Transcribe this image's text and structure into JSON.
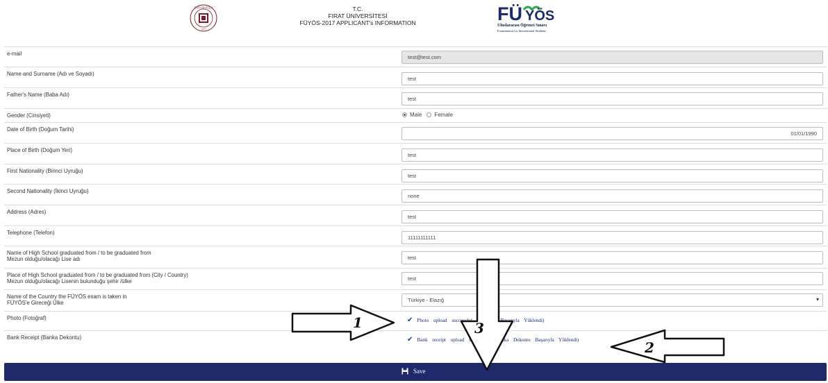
{
  "header": {
    "line1": "T.C.",
    "line2": "FIRAT ÜNİVERSİTESİ",
    "line3": "FÜYÖS-2017 APPLICANT's INFORMATION",
    "fuyos_logo": "FÜYÖS",
    "fuyos_sub1": "Uluslararası Öğrenci Sınavı",
    "fuyos_sub2": "Examination for International Students"
  },
  "form": {
    "email": {
      "label": "e-mail",
      "value": "test@test.com"
    },
    "name": {
      "label": "Name and Surname (Adı ve Soyadı)",
      "value": "test"
    },
    "father": {
      "label": "Father's Name (Baba Adı)",
      "value": "test"
    },
    "gender": {
      "label": "Gender (Cinsiyeti)",
      "male": "Male",
      "female": "Female",
      "selected": "Male"
    },
    "dob": {
      "label": "Date of Birth (Doğum Tarihi)",
      "value": "01/01/1990"
    },
    "pob": {
      "label": "Place of Birth (Doğum Yeri)",
      "value": "test"
    },
    "nat1": {
      "label": "First Nationality (Birinci Uyruğu)",
      "value": "test"
    },
    "nat2": {
      "label": "Second Nationality (İkinci Uyruğu)",
      "value": "none"
    },
    "address": {
      "label": "Address (Adres)",
      "value": "test"
    },
    "phone": {
      "label": "Telephone (Telefon)",
      "value": "11111111111"
    },
    "highschool": {
      "label1": "Name of High School graduated from / to be graduated from",
      "label2": "Mezun olduğu/olacağı Lise adı",
      "value": "test"
    },
    "hs_place": {
      "label1": "Place of High School graduated from / to be graduated from (City / Country)",
      "label2": "Mezun olduğu/olacağı Lisenin bulunduğu şehir /ülke",
      "value": "test"
    },
    "exam_country": {
      "label1": "Name of the Country the FÜYÖS exam is taken in",
      "label2": "FÜYÖS'e Gireceği Ülke",
      "value": "Türkiye - Elazığ"
    },
    "photo": {
      "label": "Photo (Fotoğraf)",
      "status": "Photo upload successful (Fotoğraf Başarıyla Yüklendi)"
    },
    "receipt": {
      "label": "Bank Receipt (Banka Dekontu)",
      "status": "Bank receipt upload successful (Banka Dekontu Başarıyla Yüklendi)"
    }
  },
  "save_label": "Save",
  "annotations": {
    "a1": "1",
    "a2": "2",
    "a3": "3"
  },
  "icons": {
    "check": "check-icon",
    "save": "floppy-disk-icon",
    "caret": "chevron-down-icon"
  }
}
